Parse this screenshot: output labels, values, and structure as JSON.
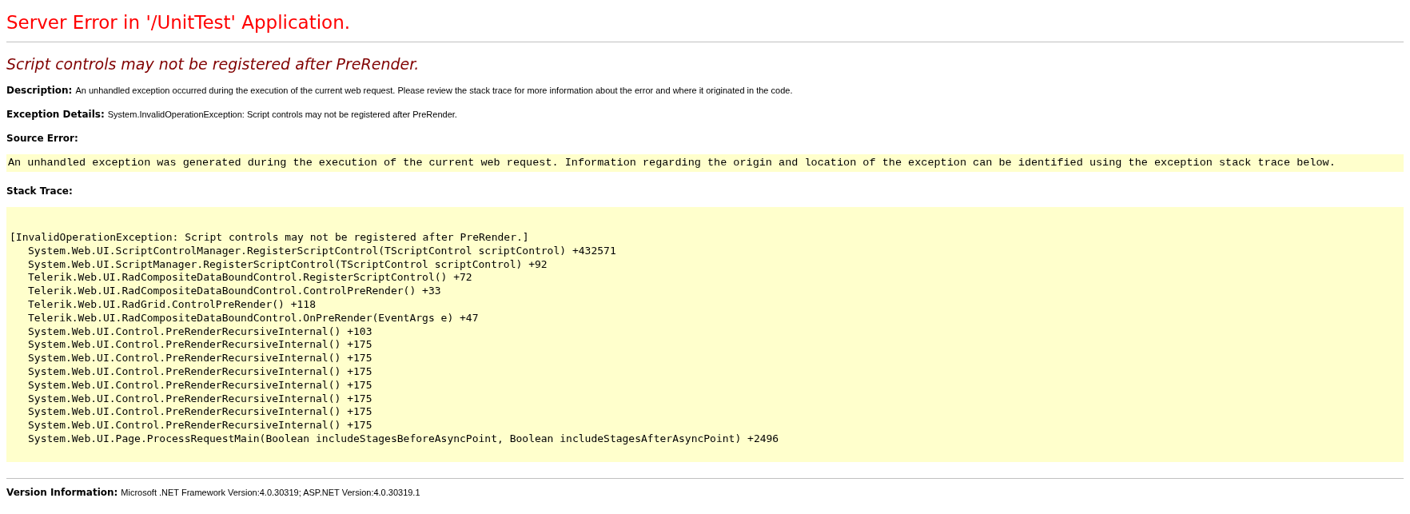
{
  "title": "Server Error in '/UnitTest' Application.",
  "message": "Script controls may not be registered after PreRender.",
  "description": {
    "label": "Description:",
    "text": "An unhandled exception occurred during the execution of the current web request. Please review the stack trace for more information about the error and where it originated in the code."
  },
  "exception_details": {
    "label": "Exception Details:",
    "text": "System.InvalidOperationException: Script controls may not be registered after PreRender."
  },
  "source_error": {
    "label": "Source Error:",
    "text": "An unhandled exception was generated during the execution of the current web request. Information regarding the origin and location of the exception can be identified using the exception stack trace below."
  },
  "stack_trace": {
    "label": "Stack Trace:",
    "exception": "[InvalidOperationException: Script controls may not be registered after PreRender.]",
    "frames": [
      "System.Web.UI.ScriptControlManager.RegisterScriptControl(TScriptControl scriptControl) +432571",
      "System.Web.UI.ScriptManager.RegisterScriptControl(TScriptControl scriptControl) +92",
      "Telerik.Web.UI.RadCompositeDataBoundControl.RegisterScriptControl() +72",
      "Telerik.Web.UI.RadCompositeDataBoundControl.ControlPreRender() +33",
      "Telerik.Web.UI.RadGrid.ControlPreRender() +118",
      "Telerik.Web.UI.RadCompositeDataBoundControl.OnPreRender(EventArgs e) +47",
      "System.Web.UI.Control.PreRenderRecursiveInternal() +103",
      "System.Web.UI.Control.PreRenderRecursiveInternal() +175",
      "System.Web.UI.Control.PreRenderRecursiveInternal() +175",
      "System.Web.UI.Control.PreRenderRecursiveInternal() +175",
      "System.Web.UI.Control.PreRenderRecursiveInternal() +175",
      "System.Web.UI.Control.PreRenderRecursiveInternal() +175",
      "System.Web.UI.Control.PreRenderRecursiveInternal() +175",
      "System.Web.UI.Control.PreRenderRecursiveInternal() +175",
      "System.Web.UI.Page.ProcessRequestMain(Boolean includeStagesBeforeAsyncPoint, Boolean includeStagesAfterAsyncPoint) +2496"
    ]
  },
  "version": {
    "label": "Version Information:",
    "text": "Microsoft .NET Framework Version:4.0.30319; ASP.NET Version:4.0.30319.1"
  }
}
